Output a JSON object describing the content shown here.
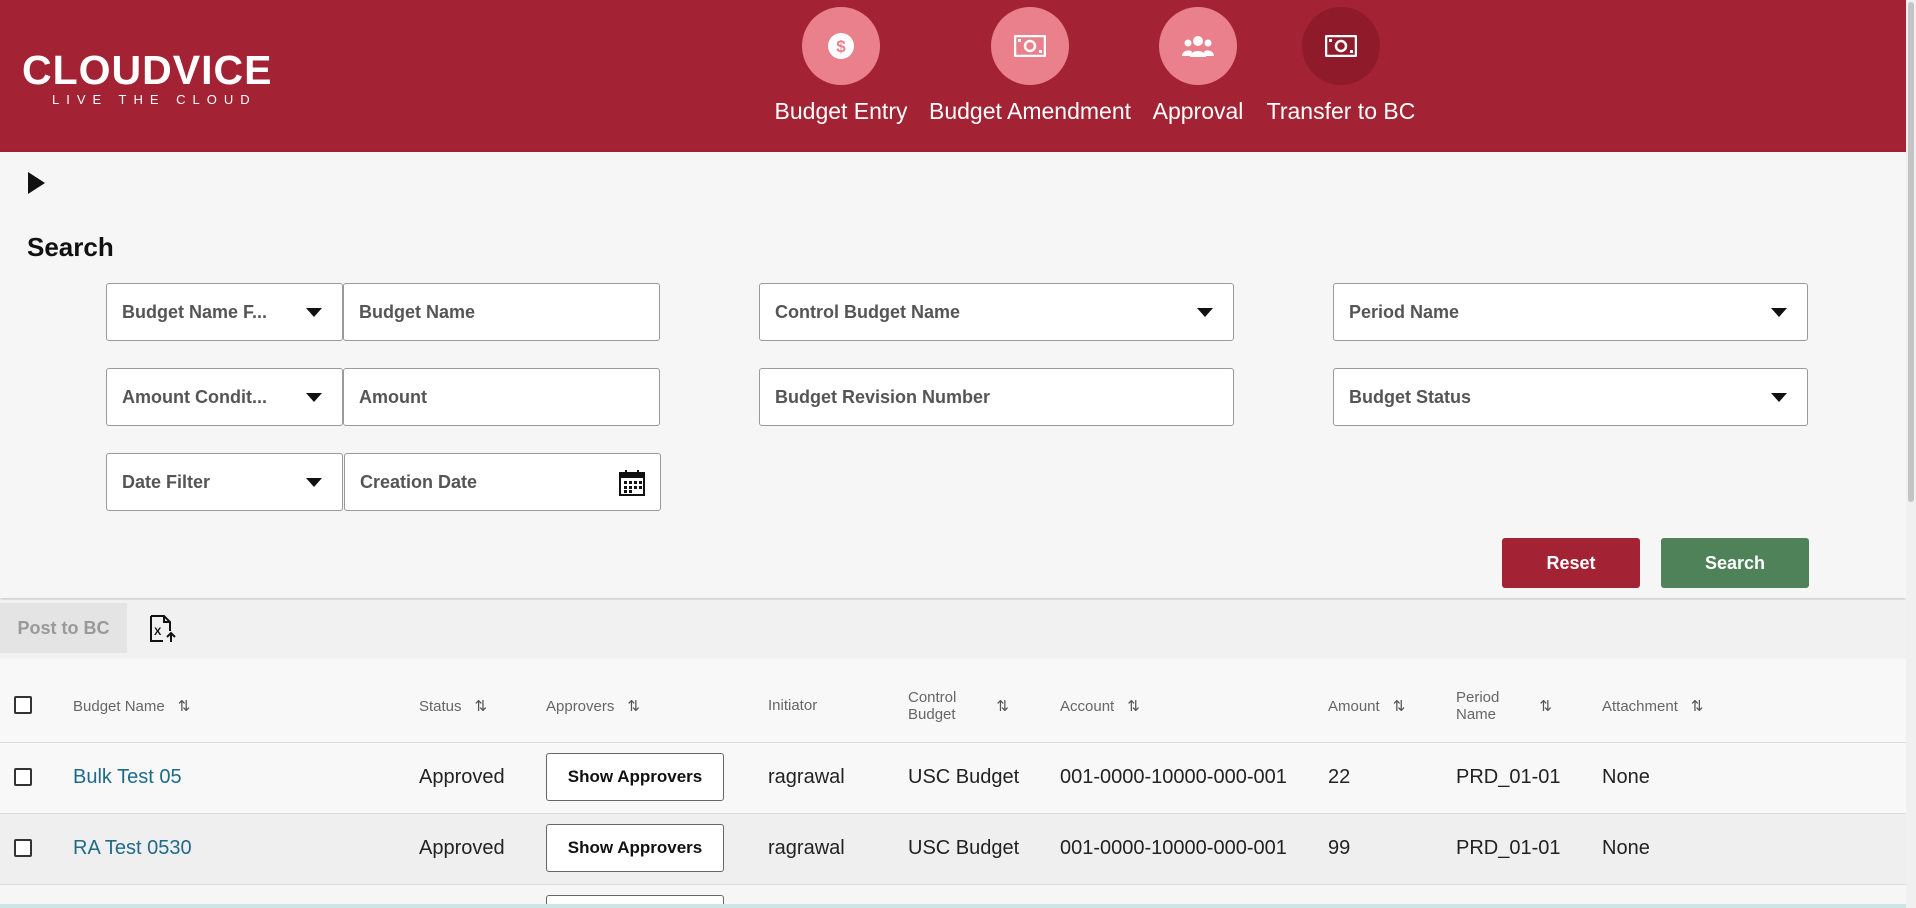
{
  "brand": {
    "name": "CLOUDVICE",
    "tagline": "LIVE THE CLOUD"
  },
  "nav": [
    {
      "label": "Budget Entry",
      "icon": "dollar-coin-icon"
    },
    {
      "label": "Budget Amendment",
      "icon": "banknote-icon"
    },
    {
      "label": "Approval",
      "icon": "users-icon"
    },
    {
      "label": "Transfer to BC",
      "icon": "banknote-icon",
      "active": true
    }
  ],
  "search": {
    "title": "Search",
    "fields": {
      "budget_name_filter": "Budget Name F...",
      "budget_name": "Budget Name",
      "control_budget_name": "Control Budget Name",
      "period_name": "Period Name",
      "amount_condition": "Amount Condit...",
      "amount": "Amount",
      "budget_revision_number": "Budget Revision Number",
      "budget_status": "Budget Status",
      "date_filter": "Date Filter",
      "creation_date": "Creation Date"
    },
    "reset_label": "Reset",
    "search_label": "Search"
  },
  "toolbar": {
    "post_label": "Post to BC"
  },
  "table": {
    "columns": {
      "budget_name": "Budget Name",
      "status": "Status",
      "approvers": "Approvers",
      "initiator": "Initiator",
      "control_budget_l1": "Control",
      "control_budget_l2": "Budget",
      "account": "Account",
      "amount": "Amount",
      "period_name_l1": "Period",
      "period_name_l2": "Name",
      "attachment": "Attachment"
    },
    "rows": [
      {
        "budget_name": "Bulk Test 05",
        "status": "Approved",
        "approvers_label": "Show Approvers",
        "initiator": "ragrawal",
        "control_budget": "USC Budget",
        "account": "001-0000-10000-000-001",
        "amount": "22",
        "period_name": "PRD_01-01",
        "attachment": "None"
      },
      {
        "budget_name": "RA Test 0530",
        "status": "Approved",
        "approvers_label": "Show Approvers",
        "initiator": "ragrawal",
        "control_budget": "USC Budget",
        "account": "001-0000-10000-000-001",
        "amount": "99",
        "period_name": "PRD_01-01",
        "attachment": "None"
      }
    ]
  },
  "colors": {
    "brand": "#a32233",
    "nav_circle": "#e9808c",
    "nav_active": "#8f1a2a",
    "search_button": "#4f8259",
    "link": "#1f6a8a"
  }
}
